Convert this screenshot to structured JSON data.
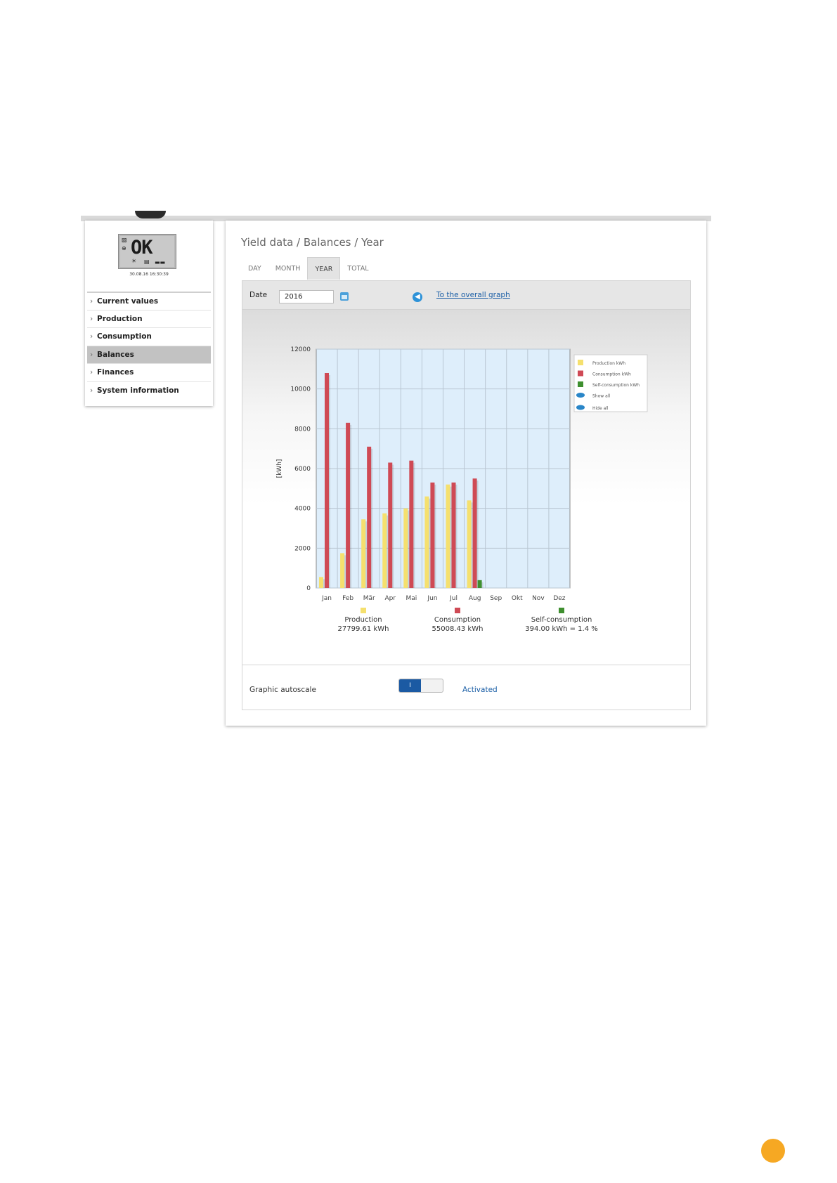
{
  "sidebar": {
    "lcd": {
      "status": "OK",
      "timestamp": "30.08.16 16:30:39"
    },
    "items": [
      {
        "label": "Current values",
        "active": false
      },
      {
        "label": "Production",
        "active": false
      },
      {
        "label": "Consumption",
        "active": false
      },
      {
        "label": "Balances",
        "active": true
      },
      {
        "label": "Finances",
        "active": false
      },
      {
        "label": "System information",
        "active": false
      }
    ]
  },
  "main": {
    "title": "Yield data / Balances / Year",
    "tabs": [
      {
        "label": "DAY",
        "active": false
      },
      {
        "label": "MONTH",
        "active": false
      },
      {
        "label": "YEAR",
        "active": true
      },
      {
        "label": "TOTAL",
        "active": false
      }
    ],
    "date_label": "Date",
    "date_value": "2016",
    "overall_link": "To the overall graph",
    "autoscale_label": "Graphic autoscale",
    "autoscale_toggle": "I",
    "autoscale_state": "Activated"
  },
  "chart_data": {
    "type": "bar",
    "ylabel": "[kWh]",
    "xlabel": "",
    "ylim": [
      0,
      12000
    ],
    "yticks": [
      0,
      2000,
      4000,
      6000,
      8000,
      10000,
      12000
    ],
    "categories": [
      "Jan",
      "Feb",
      "Mär",
      "Apr",
      "Mai",
      "Jun",
      "Jul",
      "Aug",
      "Sep",
      "Okt",
      "Nov",
      "Dez"
    ],
    "series": [
      {
        "name": "Production kWh",
        "color": "#f5e06e",
        "values": [
          550,
          1750,
          3450,
          3750,
          4000,
          4600,
          5200,
          4400,
          0,
          0,
          0,
          0
        ]
      },
      {
        "name": "Consumption kWh",
        "color": "#cf4a55",
        "values": [
          10800,
          8300,
          7100,
          6300,
          6400,
          5300,
          5300,
          5500,
          0,
          0,
          0,
          0
        ]
      },
      {
        "name": "Self-consumption kWh",
        "color": "#3f8f2f",
        "values": [
          0,
          0,
          0,
          0,
          0,
          0,
          0,
          394,
          0,
          0,
          0,
          0
        ]
      }
    ],
    "legend_actions": [
      "Show all",
      "Hide all"
    ],
    "legend_position": "right",
    "grid": true,
    "totals": [
      {
        "label": "Production",
        "value": "27799.61 kWh",
        "color": "#f5e06e"
      },
      {
        "label": "Consumption",
        "value": "55008.43 kWh",
        "color": "#cf4a55"
      },
      {
        "label": "Self-consumption",
        "value": "394.00 kWh = 1.4 %",
        "color": "#3f8f2f"
      }
    ]
  }
}
